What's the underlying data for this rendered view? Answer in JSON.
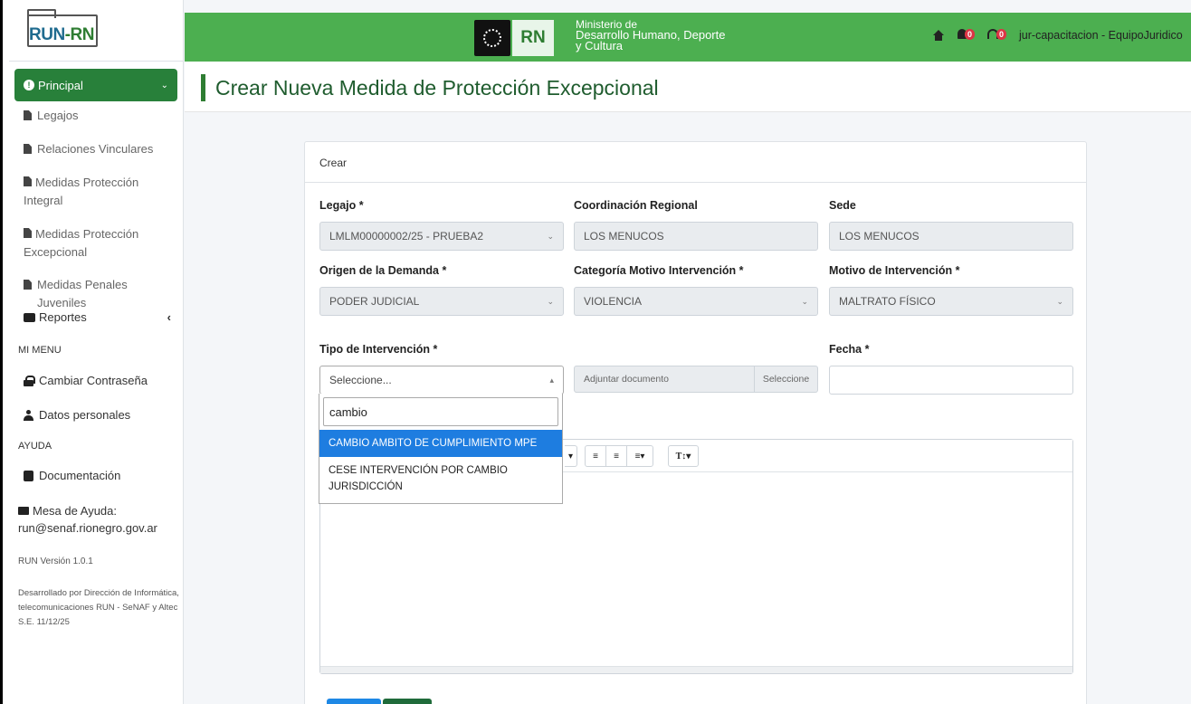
{
  "brand": {
    "logo_text_a": "RUN",
    "logo_text_b": "-RN"
  },
  "sidebar": {
    "principal": "Principal",
    "items": [
      {
        "label": "Legajos"
      },
      {
        "label": "Relaciones Vinculares"
      },
      {
        "label": "Medidas Protección Integral"
      },
      {
        "label": "Medidas Protección Excepcional"
      },
      {
        "label": "Medidas Penales Juveniles"
      }
    ],
    "reportes": "Reportes",
    "mi_menu": "MI MENU",
    "cambiar": "Cambiar Contraseña",
    "datos": "Datos personales",
    "ayuda": "AYUDA",
    "doc": "Documentación",
    "mesa_a": "Mesa de Ayuda:",
    "mesa_b": "run@senaf.rionegro.gov.ar",
    "version": "RUN Versión 1.0.1",
    "credits": "Desarrollado por Dirección de Informática, telecomunicaciones RUN - SeNAF y Altec S.E. 11/12/25"
  },
  "topbar": {
    "rn": "RN",
    "ministerio_1": "Ministerio de",
    "ministerio_2": "Desarrollo Humano, Deporte",
    "ministerio_3": "y Cultura",
    "bell_count": "0",
    "support_count": "0",
    "user": "jur-capacitacion - EquipoJuridico"
  },
  "page": {
    "title": "Crear Nueva Medida de Protección Excepcional"
  },
  "form": {
    "card_title": "Crear",
    "legajo_label": "Legajo *",
    "legajo_value": "LMLM00000002/25 - PRUEBA2",
    "coord_label": "Coordinación Regional",
    "coord_value": "LOS MENUCOS",
    "sede_label": "Sede",
    "sede_value": "LOS MENUCOS",
    "origen_label": "Origen de la Demanda *",
    "origen_value": "PODER JUDICIAL",
    "categoria_label": "Categoría Motivo Intervención *",
    "categoria_value": "VIOLENCIA",
    "motivo_label": "Motivo de Intervención *",
    "motivo_value": "MALTRATO FÍSICO",
    "tipo_label": "Tipo de Intervención *",
    "tipo_value": "Seleccione...",
    "adjuntar": "Adjuntar documento",
    "seleccione_btn": "Seleccione",
    "fecha_label": "Fecha *",
    "fecha_value": ""
  },
  "dropdown": {
    "search_value": "cambio",
    "options": [
      "CAMBIO AMBITO DE CUMPLIMIENTO MPE",
      "CESE INTERVENCIÓN POR CAMBIO JURISDICCIÓN"
    ]
  },
  "colors": {
    "accent": "#28803a",
    "topbar": "#4caf50",
    "highlight": "#1e7de0"
  }
}
